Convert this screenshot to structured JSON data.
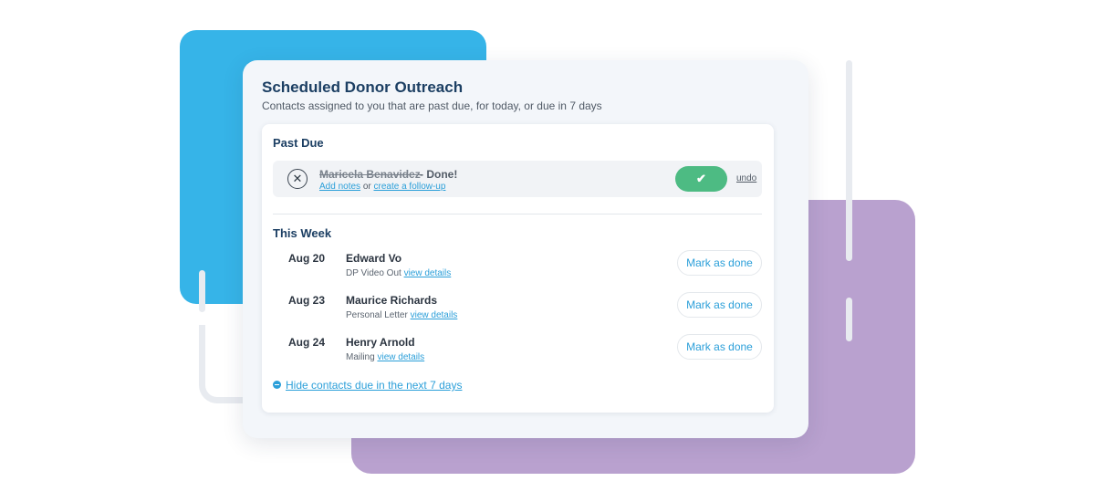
{
  "colors": {
    "title": "#1c3f63",
    "accent_blue": "#36b4e8",
    "accent_purple": "#b9a1cf",
    "success_green": "#4dbb83",
    "link_blue": "#2b9fd9"
  },
  "card": {
    "title": "Scheduled Donor Outreach",
    "subtitle": "Contacts assigned to you that are past due, for today, or due in 7 days"
  },
  "past_due": {
    "heading": "Past Due",
    "item": {
      "icon": "close-icon",
      "name": "Maricela Benavidez",
      "status_suffix": " - Done!",
      "add_notes_label": "Add notes",
      "or_text": " or ",
      "follow_up_label": "create a follow-up",
      "check_icon": "check-icon",
      "check_glyph": "✔",
      "undo_label": "undo"
    }
  },
  "this_week": {
    "heading": "This Week",
    "items": [
      {
        "date": "Aug 20",
        "name": "Edward Vo",
        "detail": "DP Video Out",
        "link": "view details",
        "button": "Mark as done"
      },
      {
        "date": "Aug 23",
        "name": "Maurice Richards",
        "detail": "Personal Letter",
        "link": "view details",
        "button": "Mark as done"
      },
      {
        "date": "Aug 24",
        "name": "Henry Arnold",
        "detail": "Mailing",
        "link": "view details",
        "button": "Mark as done"
      }
    ],
    "hide_link": "Hide contacts due in the next 7 days"
  }
}
